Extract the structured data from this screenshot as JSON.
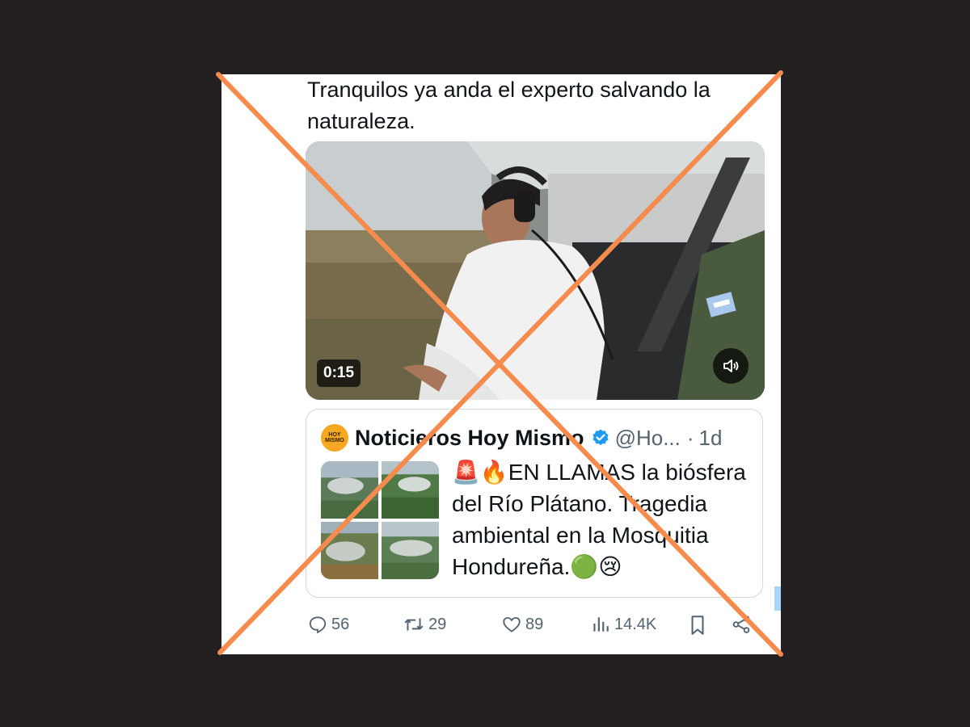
{
  "tweet": {
    "text": "Tranquilos ya anda el experto salvando la naturaleza."
  },
  "video": {
    "duration": "0:15",
    "sound_icon": "speaker-icon"
  },
  "quoted_tweet": {
    "avatar_line1": "HOY",
    "avatar_line2": "MISMO",
    "author_name": "Noticieros Hoy Mismo",
    "handle": "@Ho...",
    "separator": "·",
    "time": "1d",
    "text_prefix": "🚨🔥",
    "text": "EN LLAMAS la biósfera del Río Plátano. Tragedia ambiental en la Mosquitia Hondureña.",
    "text_suffix": "🟢😢",
    "image_count": 4
  },
  "actions": {
    "replies": "56",
    "retweets": "29",
    "likes": "89",
    "views": "14.4K"
  },
  "overlay": {
    "cross_color": "#f58b4c"
  },
  "colors": {
    "background": "#231f20",
    "card": "#ffffff",
    "text": "#0f1419",
    "muted": "#536471",
    "verified": "#1d9bf0"
  }
}
